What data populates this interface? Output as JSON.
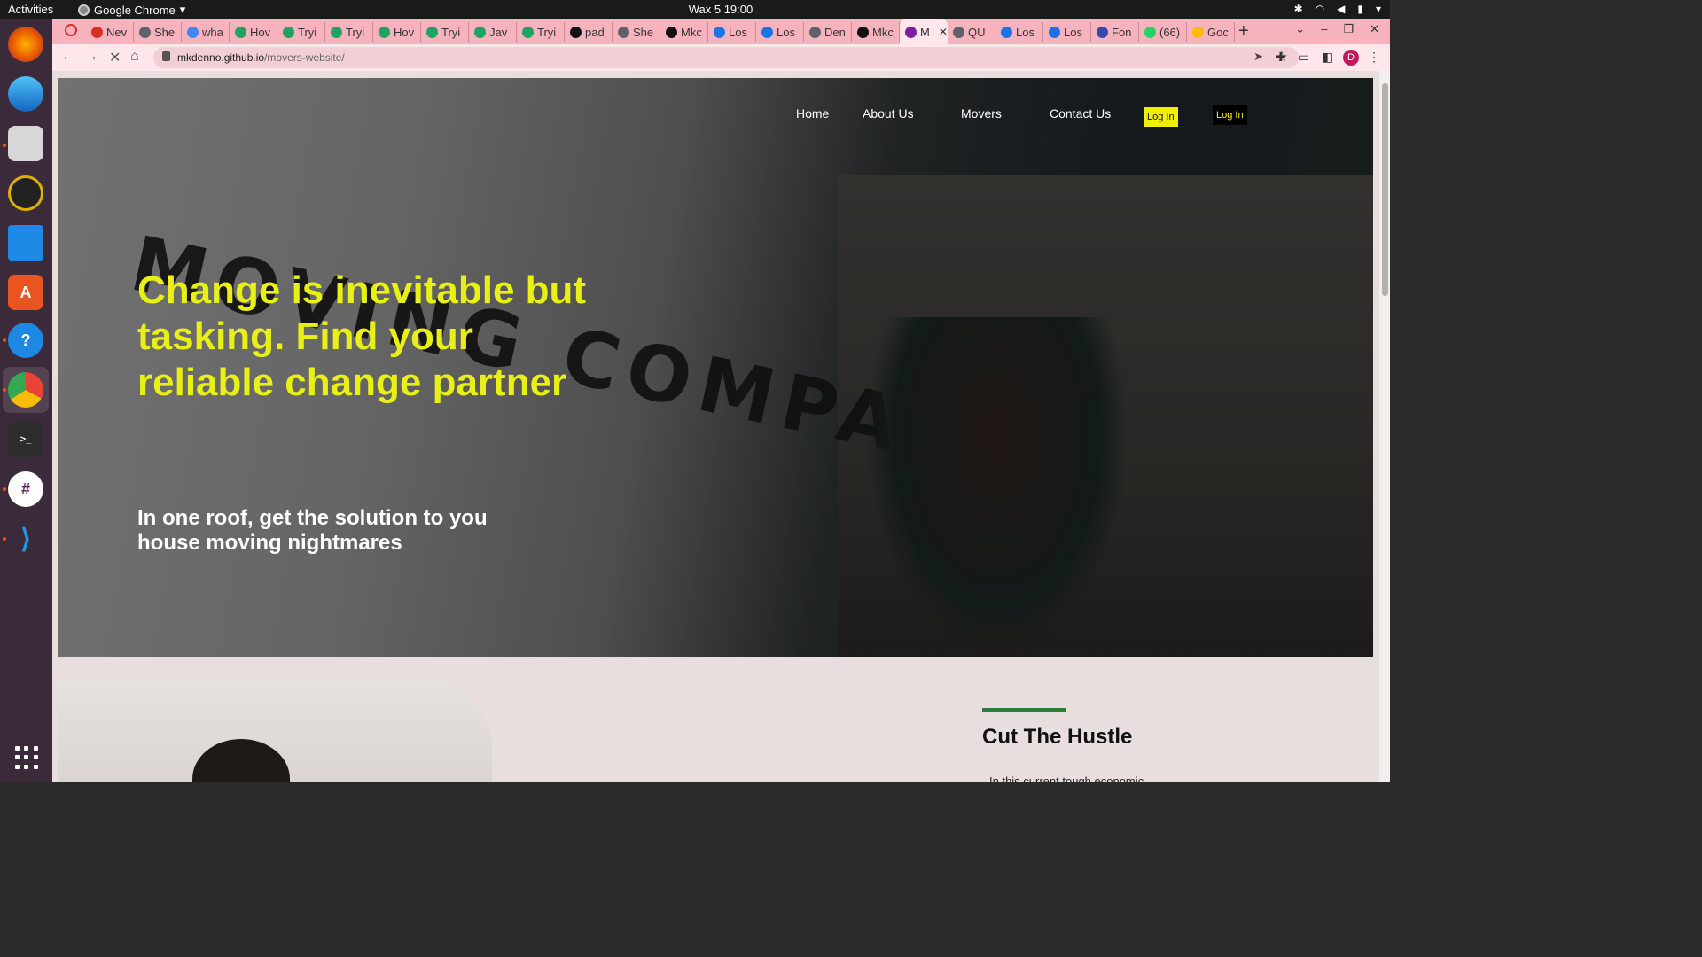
{
  "os": {
    "activities_label": "Activities",
    "app_name": "Google Chrome",
    "clock": "Wax 5  19:00"
  },
  "browser": {
    "tabs": [
      {
        "label": "Nev",
        "color": "#d93025"
      },
      {
        "label": "She",
        "color": "#5f6368"
      },
      {
        "label": "wha",
        "color": "#4285f4"
      },
      {
        "label": "Hov",
        "color": "#1da462"
      },
      {
        "label": "Tryi",
        "color": "#1da462"
      },
      {
        "label": "Tryi",
        "color": "#1da462"
      },
      {
        "label": "Hov",
        "color": "#1da462"
      },
      {
        "label": "Tryi",
        "color": "#1da462"
      },
      {
        "label": "Jav",
        "color": "#1da462"
      },
      {
        "label": "Tryi",
        "color": "#1da462"
      },
      {
        "label": "pad",
        "color": "#111111"
      },
      {
        "label": "She",
        "color": "#5f6368"
      },
      {
        "label": "Mkc",
        "color": "#111111"
      },
      {
        "label": "Los",
        "color": "#1a73e8"
      },
      {
        "label": "Los",
        "color": "#1a73e8"
      },
      {
        "label": "Den",
        "color": "#5f6368"
      },
      {
        "label": "Mkc",
        "color": "#111111"
      },
      {
        "label": "M",
        "color": "#7b1fa2"
      },
      {
        "label": "QU",
        "color": "#5f6368"
      },
      {
        "label": "Los",
        "color": "#1a73e8"
      },
      {
        "label": "Los",
        "color": "#1a73e8"
      },
      {
        "label": "Fon",
        "color": "#3949ab"
      },
      {
        "label": "(66)",
        "color": "#25d366"
      },
      {
        "label": "Goc",
        "color": "#fbbc04"
      }
    ],
    "url_host": "mkdenno.github.io",
    "url_path": "/movers-website/",
    "profile_initial": "D"
  },
  "site": {
    "nav": {
      "home": "Home",
      "about": "About Us",
      "movers": "Movers",
      "contact": "Contact Us",
      "login_primary": "Log In",
      "login_secondary": "Log In"
    },
    "hero": {
      "background_text": "MOVING COMPANY",
      "headline": "Change is inevitable but tasking. Find your reliable change partner",
      "subheadline": "In one roof, get the solution to you house moving nightmares"
    },
    "section": {
      "title": "Cut The Hustle",
      "text": "In this current tough economic"
    }
  }
}
